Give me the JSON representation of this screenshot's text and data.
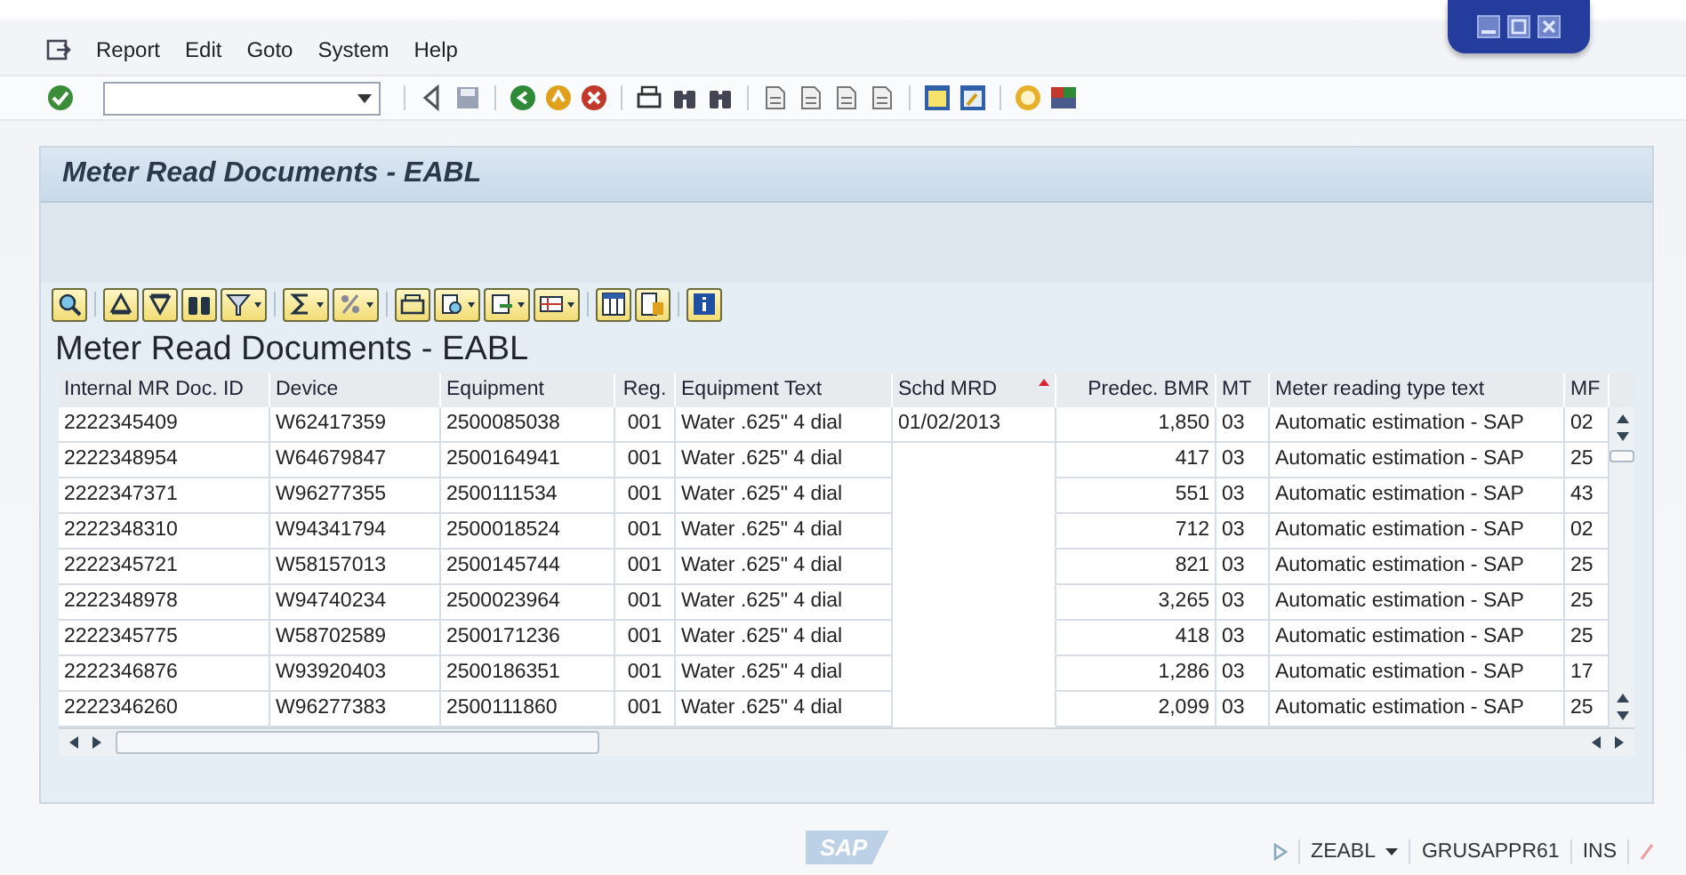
{
  "menu": {
    "items": [
      "Report",
      "Edit",
      "Goto",
      "System",
      "Help"
    ]
  },
  "screen_title": "Meter Read Documents - EABL",
  "grid": {
    "title": "Meter Read Documents - EABL",
    "columns": [
      {
        "label": "Internal MR Doc. ID",
        "kind": "text",
        "sorted": false
      },
      {
        "label": "Device",
        "kind": "text",
        "sorted": false
      },
      {
        "label": "Equipment",
        "kind": "text",
        "sorted": false
      },
      {
        "label": "Reg.",
        "kind": "center",
        "sorted": false
      },
      {
        "label": "Equipment Text",
        "kind": "text",
        "sorted": false
      },
      {
        "label": "Schd MRD",
        "kind": "text",
        "sorted": true
      },
      {
        "label": "Predec. BMR",
        "kind": "number",
        "sorted": false
      },
      {
        "label": "MT",
        "kind": "text",
        "sorted": false
      },
      {
        "label": "Meter reading type text",
        "kind": "text",
        "sorted": false
      },
      {
        "label": "MF",
        "kind": "text",
        "sorted": false
      }
    ],
    "rows": [
      [
        "2222345409",
        "W62417359",
        "2500085038",
        "001",
        "Water .625\" 4 dial",
        "01/02/2013",
        "1,850",
        "03",
        "Automatic estimation - SAP",
        "02"
      ],
      [
        "2222348954",
        "W64679847",
        "2500164941",
        "001",
        "Water .625\" 4 dial",
        null,
        "417",
        "03",
        "Automatic estimation - SAP",
        "25"
      ],
      [
        "2222347371",
        "W96277355",
        "2500111534",
        "001",
        "Water .625\" 4 dial",
        null,
        "551",
        "03",
        "Automatic estimation - SAP",
        "43"
      ],
      [
        "2222348310",
        "W94341794",
        "2500018524",
        "001",
        "Water .625\" 4 dial",
        null,
        "712",
        "03",
        "Automatic estimation - SAP",
        "02"
      ],
      [
        "2222345721",
        "W58157013",
        "2500145744",
        "001",
        "Water .625\" 4 dial",
        null,
        "821",
        "03",
        "Automatic estimation - SAP",
        "25"
      ],
      [
        "2222348978",
        "W94740234",
        "2500023964",
        "001",
        "Water .625\" 4 dial",
        null,
        "3,265",
        "03",
        "Automatic estimation - SAP",
        "25"
      ],
      [
        "2222345775",
        "W58702589",
        "2500171236",
        "001",
        "Water .625\" 4 dial",
        null,
        "418",
        "03",
        "Automatic estimation - SAP",
        "25"
      ],
      [
        "2222346876",
        "W93920403",
        "2500186351",
        "001",
        "Water .625\" 4 dial",
        null,
        "1,286",
        "03",
        "Automatic estimation - SAP",
        "17"
      ],
      [
        "2222346260",
        "W96277383",
        "2500111860",
        "001",
        "Water .625\" 4 dial",
        null,
        "2,099",
        "03",
        "Automatic estimation - SAP",
        "25"
      ]
    ]
  },
  "status_bar": {
    "logo": "SAP",
    "transaction": "ZEABL",
    "server": "GRUSAPPR61",
    "mode": "INS"
  }
}
